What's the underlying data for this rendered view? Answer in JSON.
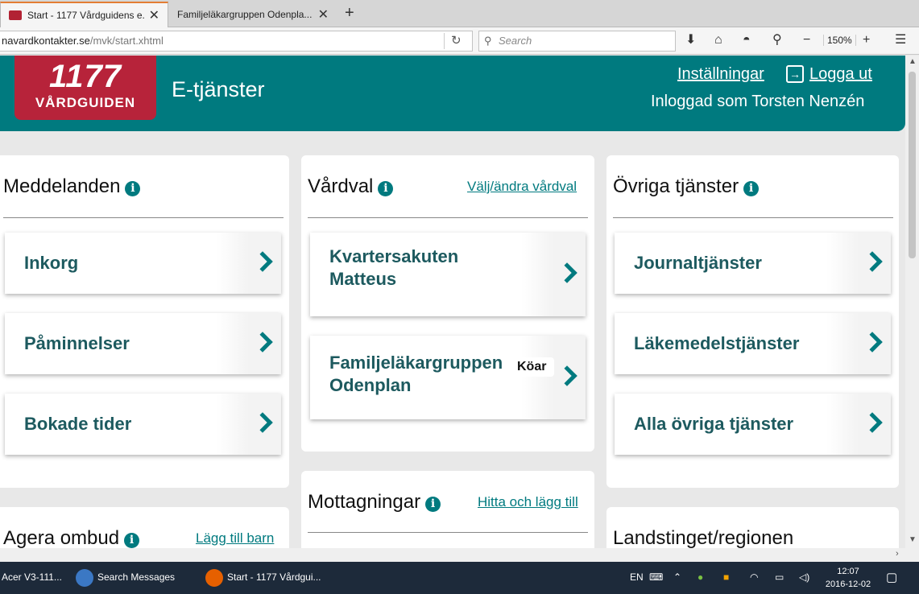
{
  "browser": {
    "tabs": [
      {
        "title": "Start - 1177 Vårdguidens e..."
      },
      {
        "title": "Familjeläkargruppen Odenpla..."
      }
    ],
    "url_host": "navardkontakter.se",
    "url_path": "/mvk/start.xhtml",
    "search_placeholder": "Search",
    "zoom": "150%"
  },
  "header": {
    "logo_number": "1177",
    "logo_text": "VÅRDGUIDEN",
    "service_title": "E-tjänster",
    "settings_label": "Inställningar",
    "logout_label": "Logga ut",
    "logged_in_text": "Inloggad som Torsten Nenzén"
  },
  "cards": {
    "messages": {
      "title": "Meddelanden",
      "items": [
        "Inkorg",
        "Påminnelser",
        "Bokade tider"
      ]
    },
    "care_choice": {
      "title": "Vårdval",
      "link": "Välj/ändra vårdval",
      "items": [
        {
          "line1": "Kvartersakuten",
          "line2": "Matteus"
        },
        {
          "line1": "Familjeläkargruppen",
          "line2": "Odenplan",
          "badge": "Köar"
        }
      ]
    },
    "other_services": {
      "title": "Övriga tjänster",
      "items": [
        "Journaltjänster",
        "Läkemedelstjänster",
        "Alla övriga tjänster"
      ]
    },
    "agent": {
      "title": "Agera ombud",
      "link": "Lägg till barn"
    },
    "clinics": {
      "title": "Mottagningar",
      "link": "Hitta och lägg till"
    },
    "region": {
      "title": "Landstinget/regionen"
    }
  },
  "taskbar": {
    "items": [
      "Acer V3-111...",
      "Search Messages",
      "Start - 1177 Vårdgui..."
    ],
    "lang": "EN",
    "time": "12:07",
    "date": "2016-12-02"
  }
}
